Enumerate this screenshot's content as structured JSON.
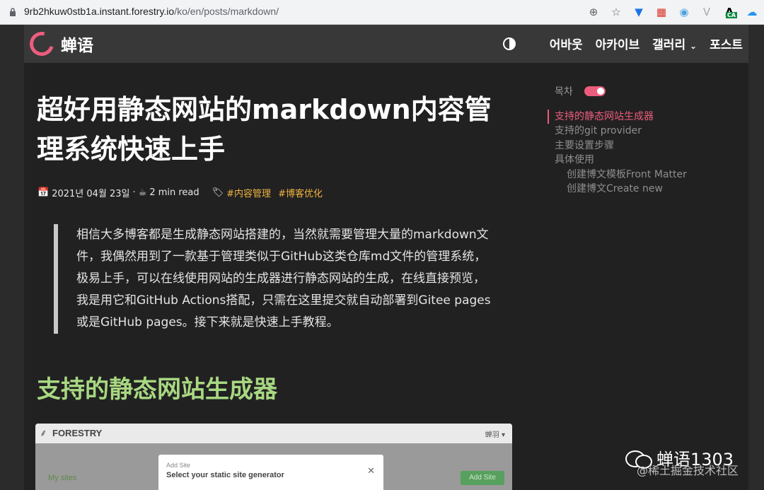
{
  "browser": {
    "url_host": "9rb2hkuw0stb1a.instant.forestry.io",
    "url_path": "/ko/en/posts/markdown/",
    "toolbar_icons": [
      "zoom-icon",
      "star-icon",
      "extension-icon",
      "calendar-icon",
      "chrome-icon",
      "extension-v-icon",
      "extension-a-icon",
      "cloud-icon"
    ],
    "ext_badge": "CA"
  },
  "site": {
    "name": "蝉语",
    "brand_color": "#ec5d7d",
    "nav": [
      "어바웃",
      "아카이브",
      "갤러리",
      "포스트"
    ]
  },
  "article": {
    "title": "超好用静态网站的markdown内容管理系统快速上手",
    "date": "2021년 04월 23일",
    "read_time": "2 min read",
    "tags": [
      "#内容管理",
      "#博客优化"
    ],
    "intro": "相信大多博客都是生成静态网站搭建的，当然就需要管理大量的markdown文件，我偶然用到了一款基于管理类似于GitHub这类仓库md文件的管理系统，极易上手，可以在线使用网站的生成器进行静态网站的生成，在线直接预览，我是用它和GitHub Actions搭配，只需在这里提交就自动部署到Gitee pages或是GitHub pages。接下来就是快速上手教程。",
    "h2": "支持的静态网站生成器"
  },
  "embed": {
    "brand": "FORESTRY",
    "user": "蝉羽 ▾",
    "sidebar_item": "My sites",
    "add_button": "Add Site",
    "dialog_small": "Add Site",
    "dialog_title": "Select your static site generator"
  },
  "toc": {
    "label": "목차",
    "items": [
      {
        "text": "支持的静态网站生成器",
        "active": true
      },
      {
        "text": "支持的git provider"
      },
      {
        "text": "主要设置步骤"
      },
      {
        "text": "具体使用"
      },
      {
        "text": "创建博文模板Front Matter",
        "sub": true
      },
      {
        "text": "创建博文Create new",
        "sub": true
      }
    ]
  },
  "watermark": {
    "main": "蝉语1303",
    "sub": "@稀土掘金技术社区"
  }
}
